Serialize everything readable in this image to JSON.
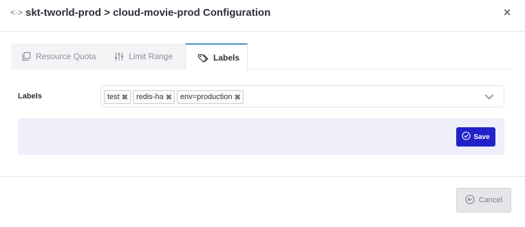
{
  "header": {
    "title": "skt-tworld-prod > cloud-movie-prod Configuration",
    "title_icon": "code-arrows-icon",
    "close_icon": "close-icon"
  },
  "tabs": [
    {
      "label": "Resource Quota",
      "icon": "copy-icon",
      "active": false
    },
    {
      "label": "Limit Range",
      "icon": "sliders-icon",
      "active": false
    },
    {
      "label": "Labels",
      "icon": "tag-icon",
      "active": true
    }
  ],
  "labels_field": {
    "label": "Labels",
    "tags": [
      "test",
      "redis-ha",
      "env=production"
    ],
    "remove_glyph": "✖",
    "dropdown_icon": "chevron-down-icon"
  },
  "actions": {
    "save_label": "Save",
    "cancel_label": "Cancel"
  },
  "colors": {
    "save_button": "#2222c8",
    "action_bar": "#eeeffa",
    "active_tab_border": "#4a90c2"
  }
}
